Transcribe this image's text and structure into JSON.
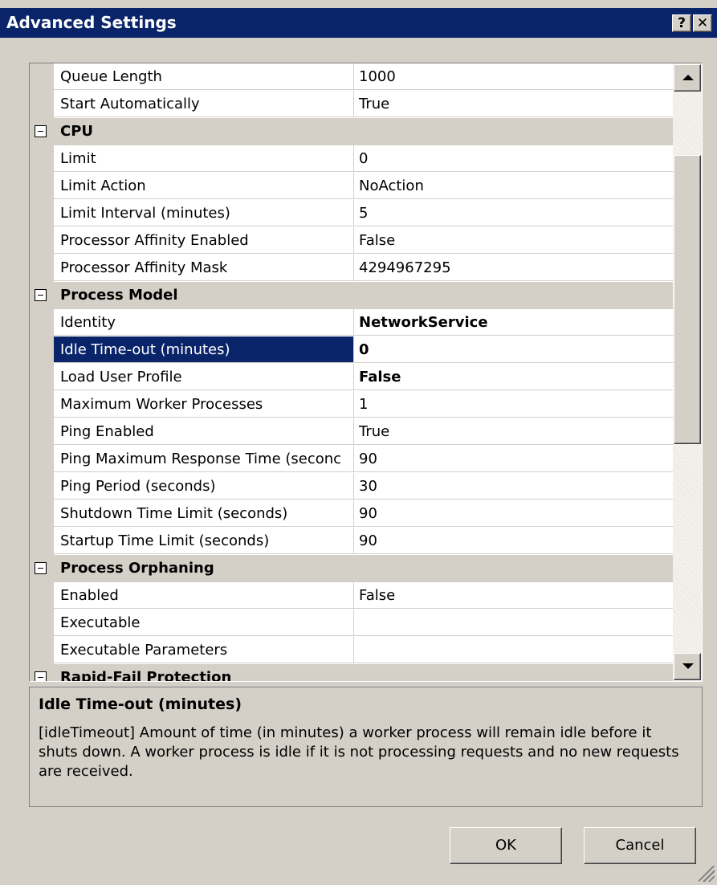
{
  "window": {
    "title": "Advanced Settings",
    "help_glyph": "?",
    "close_glyph": "✕"
  },
  "grid": {
    "rows": [
      {
        "kind": "prop",
        "name": "Queue Length",
        "value": "1000"
      },
      {
        "kind": "prop",
        "name": "Start Automatically",
        "value": "True"
      },
      {
        "kind": "cat",
        "label": "CPU"
      },
      {
        "kind": "prop",
        "name": "Limit",
        "value": "0"
      },
      {
        "kind": "prop",
        "name": "Limit Action",
        "value": "NoAction"
      },
      {
        "kind": "prop",
        "name": "Limit Interval (minutes)",
        "value": "5"
      },
      {
        "kind": "prop",
        "name": "Processor Affinity Enabled",
        "value": "False"
      },
      {
        "kind": "prop",
        "name": "Processor Affinity Mask",
        "value": "4294967295"
      },
      {
        "kind": "cat",
        "label": "Process Model"
      },
      {
        "kind": "prop",
        "name": "Identity",
        "value": "NetworkService",
        "bold": true
      },
      {
        "kind": "prop",
        "name": "Idle Time-out (minutes)",
        "value": "0",
        "bold": true,
        "selected": true
      },
      {
        "kind": "prop",
        "name": "Load User Profile",
        "value": "False",
        "bold": true
      },
      {
        "kind": "prop",
        "name": "Maximum Worker Processes",
        "value": "1"
      },
      {
        "kind": "prop",
        "name": "Ping Enabled",
        "value": "True"
      },
      {
        "kind": "prop",
        "name": "Ping Maximum Response Time (seconc",
        "value": "90"
      },
      {
        "kind": "prop",
        "name": "Ping Period (seconds)",
        "value": "30"
      },
      {
        "kind": "prop",
        "name": "Shutdown Time Limit (seconds)",
        "value": "90"
      },
      {
        "kind": "prop",
        "name": "Startup Time Limit (seconds)",
        "value": "90"
      },
      {
        "kind": "cat",
        "label": "Process Orphaning"
      },
      {
        "kind": "prop",
        "name": "Enabled",
        "value": "False"
      },
      {
        "kind": "prop",
        "name": "Executable",
        "value": ""
      },
      {
        "kind": "prop",
        "name": "Executable Parameters",
        "value": ""
      },
      {
        "kind": "cat",
        "label": "Rapid-Fail Protection"
      }
    ]
  },
  "description": {
    "title": "Idle Time-out (minutes)",
    "text": "[idleTimeout] Amount of time (in minutes) a worker process will remain idle before it shuts down. A worker process is idle if it is not processing requests and no new requests are received."
  },
  "buttons": {
    "ok": "OK",
    "cancel": "Cancel"
  },
  "colors": {
    "titlebar": "#0a246a",
    "selection": "#0a246a",
    "face": "#d4d0c8"
  }
}
